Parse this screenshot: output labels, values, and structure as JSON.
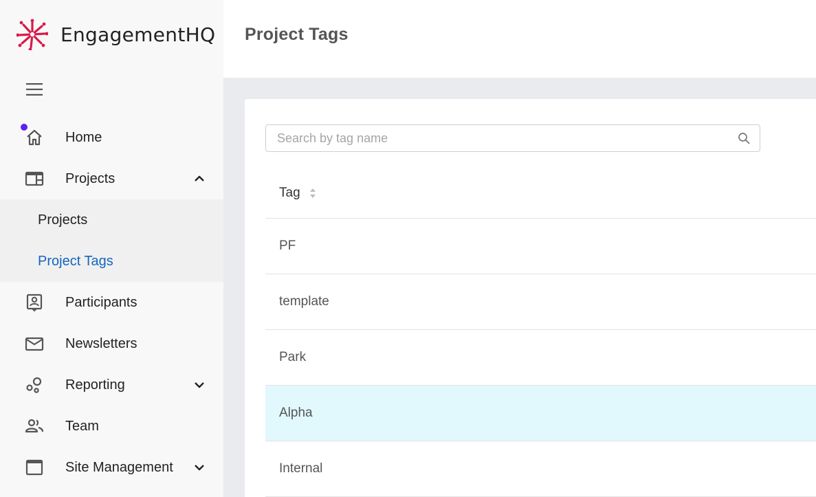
{
  "brand": {
    "name": "EngagementHQ",
    "accent": "#d81b4a"
  },
  "header": {
    "title": "Project Tags"
  },
  "sidebar": {
    "items": [
      {
        "label": "Home",
        "icon": "home-icon"
      },
      {
        "label": "Projects",
        "icon": "projects-icon",
        "expanded": true,
        "children": [
          {
            "label": "Projects"
          },
          {
            "label": "Project Tags",
            "active": true
          }
        ]
      },
      {
        "label": "Participants",
        "icon": "participants-icon"
      },
      {
        "label": "Newsletters",
        "icon": "mail-icon"
      },
      {
        "label": "Reporting",
        "icon": "reporting-icon",
        "expanded": false
      },
      {
        "label": "Team",
        "icon": "team-icon"
      },
      {
        "label": "Site Management",
        "icon": "site-management-icon",
        "expanded": false
      }
    ],
    "notification_color": "#5b21f0"
  },
  "search": {
    "placeholder": "Search by tag name",
    "value": ""
  },
  "table": {
    "columns": [
      {
        "label": "Tag",
        "sortable": true
      }
    ],
    "rows": [
      {
        "tag": "PF"
      },
      {
        "tag": "template"
      },
      {
        "tag": "Park"
      },
      {
        "tag": "Alpha",
        "highlighted": true
      },
      {
        "tag": "Internal"
      }
    ]
  },
  "colors": {
    "active_link": "#1565c0",
    "row_highlight": "#e1f8fd"
  }
}
